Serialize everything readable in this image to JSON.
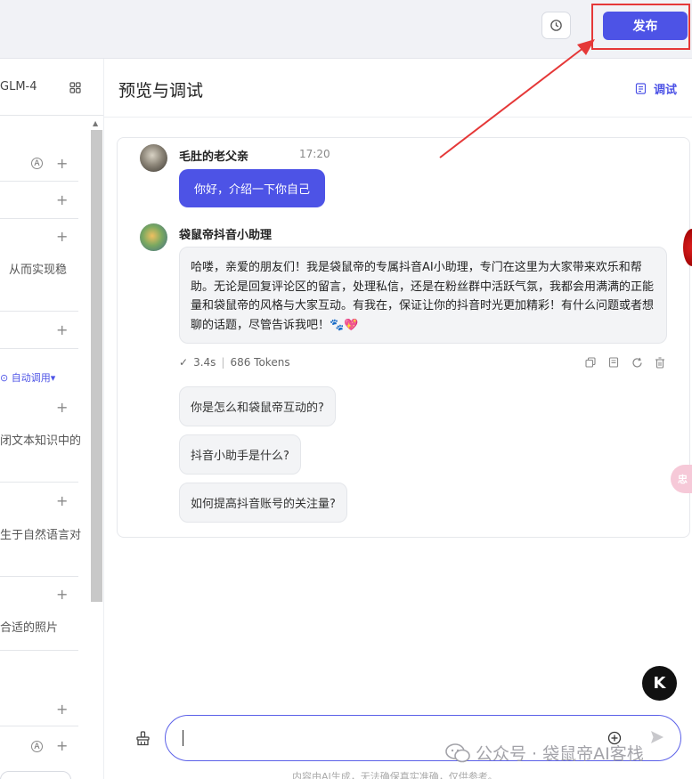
{
  "topbar": {
    "publish_label": "发布"
  },
  "left_panel": {
    "model_name": "GLM-4",
    "text_1": "从而实现稳",
    "auto_call": "自动调用▾",
    "text_2": "闭文本知识中的",
    "text_3": "生于自然语言对",
    "text_4": "合适的照片"
  },
  "main": {
    "title": "预览与调试",
    "debug_label": "调试"
  },
  "chat": {
    "user": {
      "name": "毛肚的老父亲",
      "time": "17:20",
      "message": "你好，介绍一下你自己"
    },
    "bot": {
      "name": "袋鼠帝抖音小助理",
      "message": "哈喽，亲爱的朋友们！我是袋鼠帝的专属抖音AI小助理，专门在这里为大家带来欢乐和帮助。无论是回复评论区的留言，处理私信，还是在粉丝群中活跃气氛，我都会用满满的正能量和袋鼠帝的风格与大家互动。有我在，保证让你的抖音时光更加精彩！有什么问题或者想聊的话题，尽管告诉我吧！🐾💖",
      "duration": "3.4s",
      "tokens": "686 Tokens"
    },
    "suggestions": [
      "你是怎么和袋鼠帝互动的?",
      "抖音小助手是什么?",
      "如何提高抖音账号的关注量?"
    ]
  },
  "side_pink_label": "忠",
  "k_logo": "K",
  "watermark": "公众号 · 袋鼠帝AI客栈",
  "disclaimer": "内容由AI生成，无法确保真实准确，仅供参考。",
  "colors": {
    "accent": "#4d53e6",
    "highlight_red": "#e53838"
  }
}
